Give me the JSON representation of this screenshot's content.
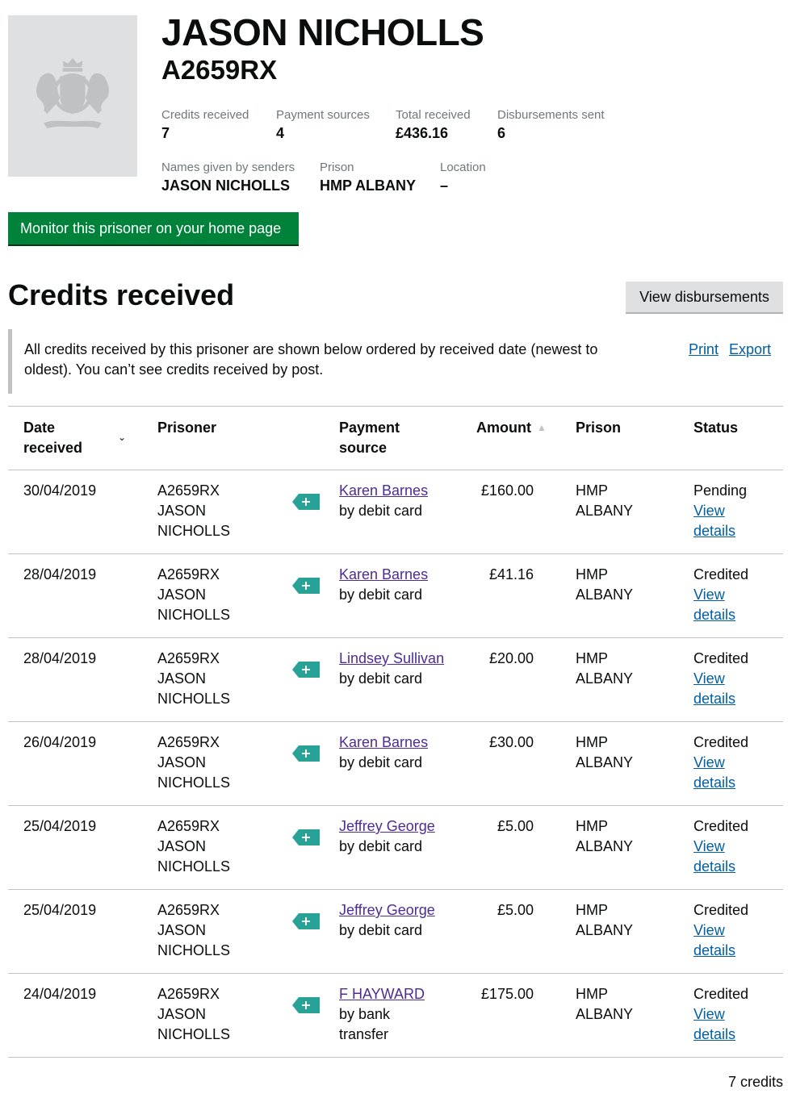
{
  "prisoner": {
    "name": "JASON NICHOLLS",
    "number": "A2659RX",
    "photo_icon": "royal-crest-icon"
  },
  "stats": {
    "credits_received": {
      "label": "Credits received",
      "value": "7"
    },
    "payment_sources": {
      "label": "Payment sources",
      "value": "4"
    },
    "total_received": {
      "label": "Total received",
      "value": "£436.16"
    },
    "disbursements_sent": {
      "label": "Disbursements sent",
      "value": "6"
    },
    "names_given": {
      "label": "Names given by senders",
      "value": "JASON NICHOLLS"
    },
    "prison": {
      "label": "Prison",
      "value": "HMP ALBANY"
    },
    "location": {
      "label": "Location",
      "value": "–"
    }
  },
  "actions": {
    "monitor_label": "Monitor this prisoner on your home page",
    "view_disbursements_label": "View disbursements",
    "print_label": "Print",
    "export_label": "Export"
  },
  "section": {
    "title": "Credits received",
    "notice": "All credits received by this prisoner are shown below ordered by received date (newest to oldest). You can’t see credits received by post."
  },
  "table": {
    "headers": {
      "date_line1": "Date",
      "date_line2": "received",
      "prisoner": "Prisoner",
      "source_line1": "Payment",
      "source_line2": "source",
      "amount": "Amount",
      "prison": "Prison",
      "status": "Status"
    },
    "rows": [
      {
        "date": "30/04/2019",
        "pnum": "A2659RX",
        "pfirst": "JASON",
        "plast": "NICHOLLS",
        "sender": "Karen Barnes ",
        "method": "by debit card",
        "method2": "",
        "amount": "£160.00",
        "prison1": "HMP",
        "prison2": "ALBANY",
        "status": "Pending",
        "view1": "View",
        "view2": "details"
      },
      {
        "date": "28/04/2019",
        "pnum": "A2659RX",
        "pfirst": "JASON",
        "plast": "NICHOLLS",
        "sender": "Karen Barnes ",
        "method": "by debit card",
        "method2": "",
        "amount": "£41.16",
        "prison1": "HMP",
        "prison2": "ALBANY",
        "status": "Credited",
        "view1": "View",
        "view2": "details"
      },
      {
        "date": "28/04/2019",
        "pnum": "A2659RX",
        "pfirst": "JASON",
        "plast": "NICHOLLS",
        "sender": "Lindsey Sullivan",
        "method": "by debit card",
        "method2": "",
        "amount": "£20.00",
        "prison1": "HMP",
        "prison2": "ALBANY",
        "status": "Credited",
        "view1": "View",
        "view2": "details"
      },
      {
        "date": "26/04/2019",
        "pnum": "A2659RX",
        "pfirst": "JASON",
        "plast": "NICHOLLS",
        "sender": "Karen Barnes ",
        "method": "by debit card",
        "method2": "",
        "amount": "£30.00",
        "prison1": "HMP",
        "prison2": "ALBANY",
        "status": "Credited",
        "view1": "View",
        "view2": "details"
      },
      {
        "date": "25/04/2019",
        "pnum": "A2659RX",
        "pfirst": "JASON",
        "plast": "NICHOLLS",
        "sender": "Jeffrey George ",
        "method": "by debit card",
        "method2": "",
        "amount": "£5.00",
        "prison1": "HMP",
        "prison2": "ALBANY",
        "status": "Credited",
        "view1": "View",
        "view2": "details"
      },
      {
        "date": "25/04/2019",
        "pnum": "A2659RX",
        "pfirst": "JASON",
        "plast": "NICHOLLS",
        "sender": "Jeffrey George ",
        "method": "by debit card",
        "method2": "",
        "amount": "£5.00",
        "prison1": "HMP",
        "prison2": "ALBANY",
        "status": "Credited",
        "view1": "View",
        "view2": "details"
      },
      {
        "date": "24/04/2019",
        "pnum": "A2659RX",
        "pfirst": "JASON",
        "plast": "NICHOLLS",
        "sender": "F HAYWARD ",
        "method": "by bank",
        "method2": "transfer",
        "amount": "£175.00",
        "prison1": "HMP",
        "prison2": "ALBANY",
        "status": "Credited",
        "view1": "View",
        "view2": "details"
      }
    ],
    "tag_icon": "credit-tag-icon",
    "tag_color": "#28a197"
  },
  "footer": {
    "count": "7 credits"
  },
  "colors": {
    "monitor_button": "#00823b",
    "link": "#005ea5",
    "visited_link": "#4c2c92"
  }
}
